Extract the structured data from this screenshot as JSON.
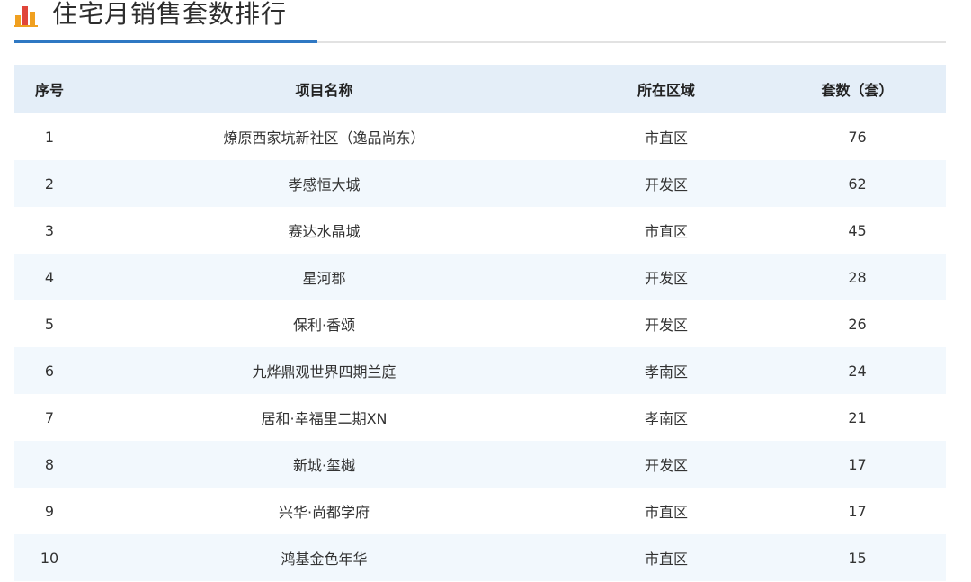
{
  "title": "住宅月销售套数排行",
  "colors": {
    "accent": "#2f78c3",
    "icon_gold": "#f0a020",
    "icon_red": "#e0453a",
    "header_bg": "#e4eef8",
    "stripe_bg": "#f2f8fd"
  },
  "icons": {
    "title_icon": "bar-chart-icon"
  },
  "table": {
    "headers": [
      "序号",
      "项目名称",
      "所在区域",
      "套数（套）"
    ],
    "rows": [
      {
        "rank": "1",
        "name": "燎原西家坑新社区（逸品尚东）",
        "area": "市直区",
        "units": "76"
      },
      {
        "rank": "2",
        "name": "孝感恒大城",
        "area": "开发区",
        "units": "62"
      },
      {
        "rank": "3",
        "name": "赛达水晶城",
        "area": "市直区",
        "units": "45"
      },
      {
        "rank": "4",
        "name": "星河郡",
        "area": "开发区",
        "units": "28"
      },
      {
        "rank": "5",
        "name": "保利·香颂",
        "area": "开发区",
        "units": "26"
      },
      {
        "rank": "6",
        "name": "九烨鼎观世界四期兰庭",
        "area": "孝南区",
        "units": "24"
      },
      {
        "rank": "7",
        "name": "居和·幸福里二期XN",
        "area": "孝南区",
        "units": "21"
      },
      {
        "rank": "8",
        "name": "新城·玺樾",
        "area": "开发区",
        "units": "17"
      },
      {
        "rank": "9",
        "name": "兴华·尚都学府",
        "area": "市直区",
        "units": "17"
      },
      {
        "rank": "10",
        "name": "鸿基金色年华",
        "area": "市直区",
        "units": "15"
      }
    ]
  }
}
